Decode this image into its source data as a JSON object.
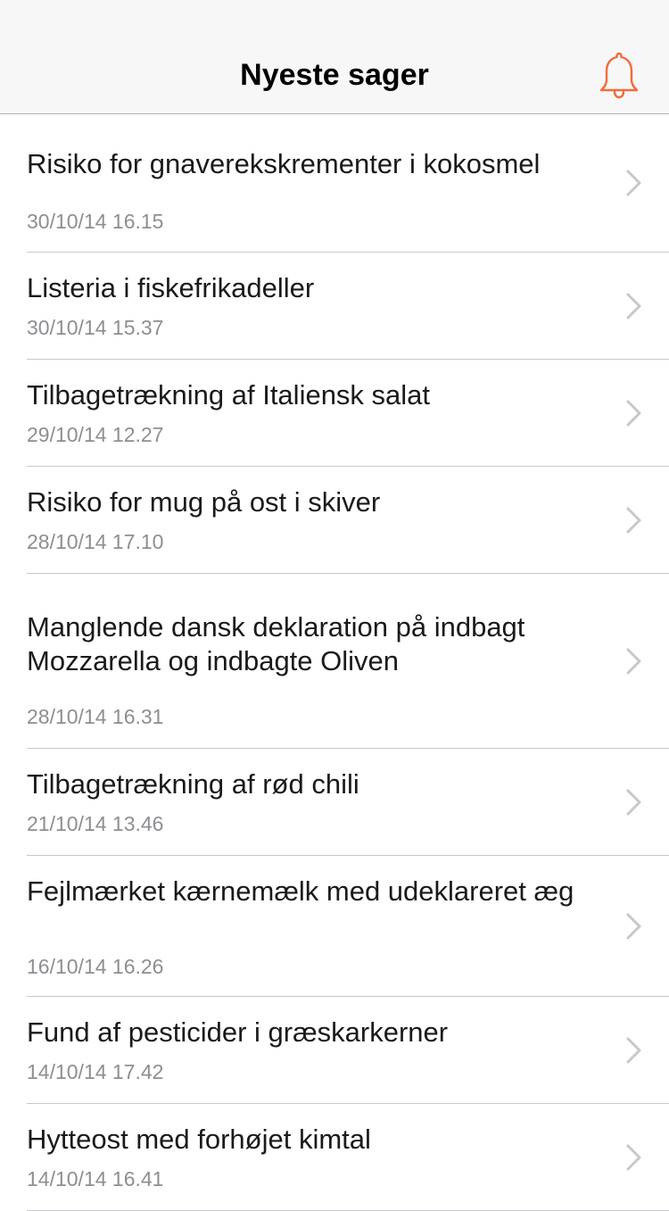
{
  "header": {
    "title": "Nyeste sager",
    "bell_icon": "bell-icon",
    "accent_color": "#f26b3a"
  },
  "items": [
    {
      "title": "Risiko for gnaverekskrementer i kokosmel",
      "date": "30/10/14 16.15"
    },
    {
      "title": "Listeria i fiskefrikadeller",
      "date": "30/10/14 15.37"
    },
    {
      "title": "Tilbagetrækning af Italiensk salat",
      "date": "29/10/14 12.27"
    },
    {
      "title": "Risiko for mug på ost i skiver",
      "date": "28/10/14 17.10"
    },
    {
      "title": "Manglende dansk deklaration på indbagt Mozzarella og indbagte Oliven",
      "date": "28/10/14 16.31"
    },
    {
      "title": "Tilbagetrækning af rød chili",
      "date": "21/10/14 13.46"
    },
    {
      "title": "Fejlmærket kærnemælk med udeklareret æg",
      "date": "16/10/14 16.26"
    },
    {
      "title": "Fund af pesticider i græskarkerner",
      "date": "14/10/14 17.42"
    },
    {
      "title": "Hytteost med forhøjet kimtal",
      "date": "14/10/14 16.41"
    }
  ]
}
